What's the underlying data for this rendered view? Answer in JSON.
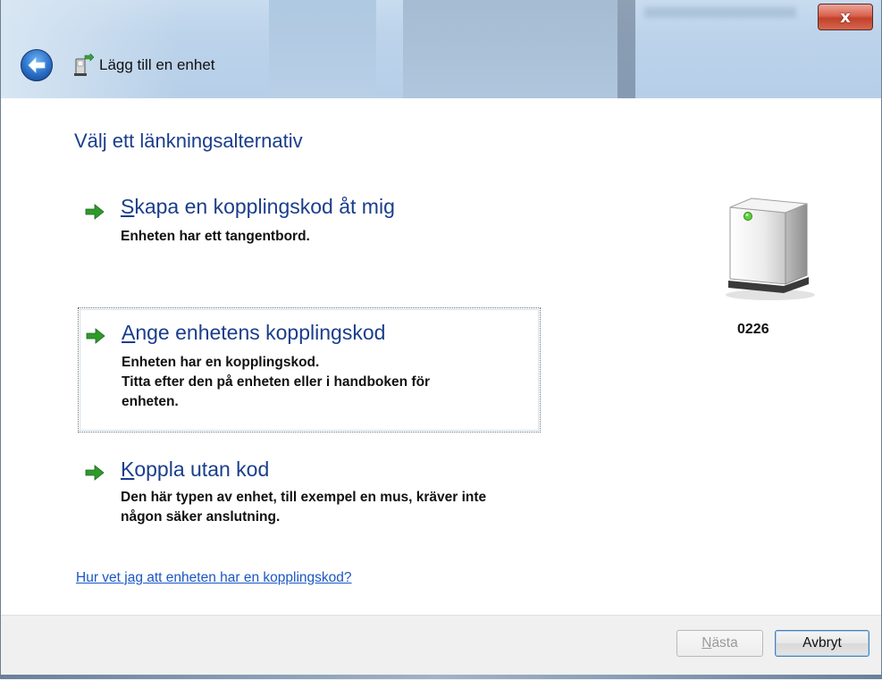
{
  "window": {
    "title": "Lägg till en enhet",
    "close_label": "x"
  },
  "page": {
    "heading": "Välj ett länkningsalternativ"
  },
  "options": [
    {
      "label_accel": "S",
      "label_rest": "kapa en kopplingskod åt mig",
      "desc": [
        "Enheten har ett tangentbord."
      ]
    },
    {
      "label_accel": "A",
      "label_rest": "nge enhetens kopplingskod",
      "desc": [
        "Enheten har en kopplingskod.",
        "Titta efter den på enheten eller i handboken för",
        "enheten."
      ]
    },
    {
      "label_accel": "K",
      "label_rest": "oppla utan kod",
      "desc": [
        "Den här typen av enhet, till exempel en mus, kräver inte",
        "någon säker anslutning."
      ]
    }
  ],
  "help_link": "Hur vet jag att enheten har en kopplingskod?",
  "device": {
    "label": "0226",
    "icon": "device-icon"
  },
  "buttons": {
    "next_accel": "N",
    "next_rest": "ästa",
    "cancel": "Avbryt"
  },
  "colors": {
    "heading": "#1a3e8c",
    "link": "#1a56c4",
    "arrow_green": "#2f9a2b"
  }
}
